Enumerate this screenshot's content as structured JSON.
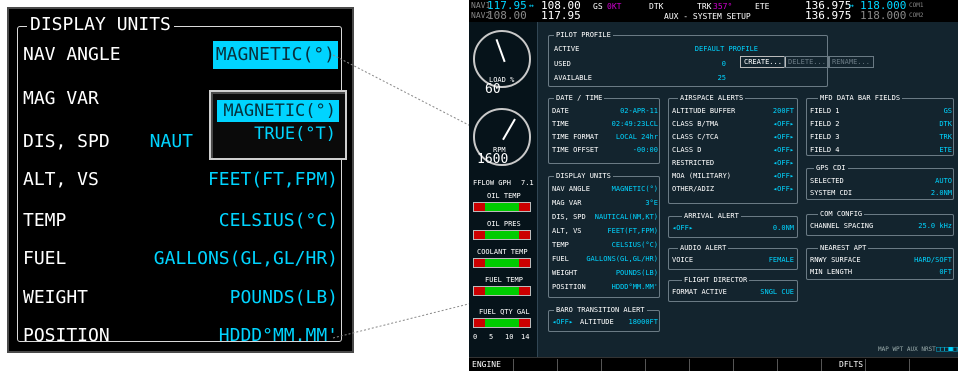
{
  "zoom": {
    "title": "DISPLAY UNITS",
    "rows": [
      {
        "label": "NAV ANGLE",
        "value": "MAGNETIC(°)"
      },
      {
        "label": "MAG VAR",
        "value": ""
      },
      {
        "label": "DIS, SPD",
        "value": "NAUT"
      },
      {
        "label": "ALT, VS",
        "value": "FEET(FT,FPM)"
      },
      {
        "label": "TEMP",
        "value": "CELSIUS(°C)"
      },
      {
        "label": "FUEL",
        "value": "GALLONS(GL,GL/HR)"
      },
      {
        "label": "WEIGHT",
        "value": "POUNDS(LB)"
      },
      {
        "label": "POSITION",
        "value": "HDDD°MM.MM'"
      }
    ],
    "popup": {
      "options": [
        "MAGNETIC(°)",
        "TRUE(°T)"
      ],
      "selected": 0
    }
  },
  "screen": {
    "topbar": {
      "nav1_label": "NAV1",
      "nav1_active": "117.95",
      "nav1_swap": "↔",
      "nav1_standby": "108.00",
      "nav2_label": "NAV2",
      "nav2_active": "108.00",
      "nav2_standby": "117.95",
      "gs_label": "GS",
      "gs_value": "0KT",
      "dtk_label": "DTK",
      "trk_label": "TRK",
      "trk_value": "357°",
      "ete_label": "ETE",
      "page_title": "AUX - SYSTEM SETUP",
      "com1_active": "136.975",
      "com1_swap": "↔",
      "com1_standby": "118.000",
      "com1_label": "COM1",
      "com2_active": "136.975",
      "com2_standby": "118.000",
      "com2_label": "COM2"
    },
    "instruments": {
      "load_label": "LOAD %",
      "load_value": "60",
      "rpm_label": "RPM",
      "rpm_value": "1600",
      "fflow_label": "FFLOW GPH",
      "fflow_value": "7.1",
      "oil_temp": "OIL TEMP",
      "oil_pres": "OIL PRES",
      "coolant_temp": "COOLANT TEMP",
      "fuel_temp": "FUEL TEMP",
      "fuel_qty": "FUEL QTY GAL",
      "fuel_scale": [
        "0",
        "5",
        "10",
        "14"
      ]
    },
    "pilot_profile": {
      "title": "PILOT PROFILE",
      "active_label": "ACTIVE",
      "active_value": "DEFAULT PROFILE",
      "used_label": "USED",
      "used_value": "0",
      "available_label": "AVAILABLE",
      "available_value": "25",
      "create": "CREATE...",
      "delete": "DELETE...",
      "rename": "RENAME..."
    },
    "date_time": {
      "title": "DATE / TIME",
      "rows": [
        {
          "label": "DATE",
          "value": "02-APR-11"
        },
        {
          "label": "TIME",
          "value": "02:49:23LCL"
        },
        {
          "label": "TIME FORMAT",
          "value": "LOCAL 24hr"
        },
        {
          "label": "TIME OFFSET",
          "value": "-00:00"
        }
      ]
    },
    "display_units": {
      "title": "DISPLAY UNITS",
      "rows": [
        {
          "label": "NAV ANGLE",
          "value": "MAGNETIC(°)"
        },
        {
          "label": "MAG VAR",
          "value": "3°E"
        },
        {
          "label": "DIS, SPD",
          "value": "NAUTICAL(NM,KT)"
        },
        {
          "label": "ALT, VS",
          "value": "FEET(FT,FPM)"
        },
        {
          "label": "TEMP",
          "value": "CELSIUS(°C)"
        },
        {
          "label": "FUEL",
          "value": "GALLONS(GL,GL/HR)"
        },
        {
          "label": "WEIGHT",
          "value": "POUNDS(LB)"
        },
        {
          "label": "POSITION",
          "value": "HDDD°MM.MM'"
        }
      ]
    },
    "baro": {
      "title": "BARO TRANSITION ALERT",
      "state": "◂OFF▸",
      "alt_label": "ALTITUDE",
      "alt_value": "18000FT"
    },
    "airspace": {
      "title": "AIRSPACE ALERTS",
      "rows": [
        {
          "label": "ALTITUDE BUFFER",
          "value": "200FT"
        },
        {
          "label": "CLASS B/TMA",
          "value": "◂OFF▸"
        },
        {
          "label": "CLASS C/TCA",
          "value": "◂OFF▸"
        },
        {
          "label": "CLASS D",
          "value": "◂OFF▸"
        },
        {
          "label": "RESTRICTED",
          "value": "◂OFF▸"
        },
        {
          "label": "MOA (MILITARY)",
          "value": "◂OFF▸"
        },
        {
          "label": "OTHER/ADIZ",
          "value": "◂OFF▸"
        }
      ]
    },
    "arrival": {
      "title": "ARRIVAL ALERT",
      "state": "◂OFF▸",
      "value": "0.0NM"
    },
    "audio": {
      "title": "AUDIO ALERT",
      "label": "VOICE",
      "value": "FEMALE"
    },
    "flight_director": {
      "title": "FLIGHT DIRECTOR",
      "label": "FORMAT ACTIVE",
      "value": "SNGL CUE"
    },
    "mfd_fields": {
      "title": "MFD DATA BAR FIELDS",
      "rows": [
        {
          "label": "FIELD 1",
          "value": "GS"
        },
        {
          "label": "FIELD 2",
          "value": "DTK"
        },
        {
          "label": "FIELD 3",
          "value": "TRK"
        },
        {
          "label": "FIELD 4",
          "value": "ETE"
        }
      ]
    },
    "gps_cdi": {
      "title": "GPS CDI",
      "rows": [
        {
          "label": "SELECTED",
          "value": "AUTO"
        },
        {
          "label": "SYSTEM CDI",
          "value": "2.0NM"
        }
      ]
    },
    "com_config": {
      "title": "COM CONFIG",
      "label": "CHANNEL SPACING",
      "value": "25.0 kHz"
    },
    "nearest_apt": {
      "title": "NEAREST APT",
      "rows": [
        {
          "label": "RNWY SURFACE",
          "value": "HARD/SOFT"
        },
        {
          "label": "MIN LENGTH",
          "value": "0FT"
        }
      ]
    },
    "page_indicator": "MAP WPT AUX NRST",
    "softkeys": [
      "ENGINE",
      "DFLTS"
    ]
  }
}
